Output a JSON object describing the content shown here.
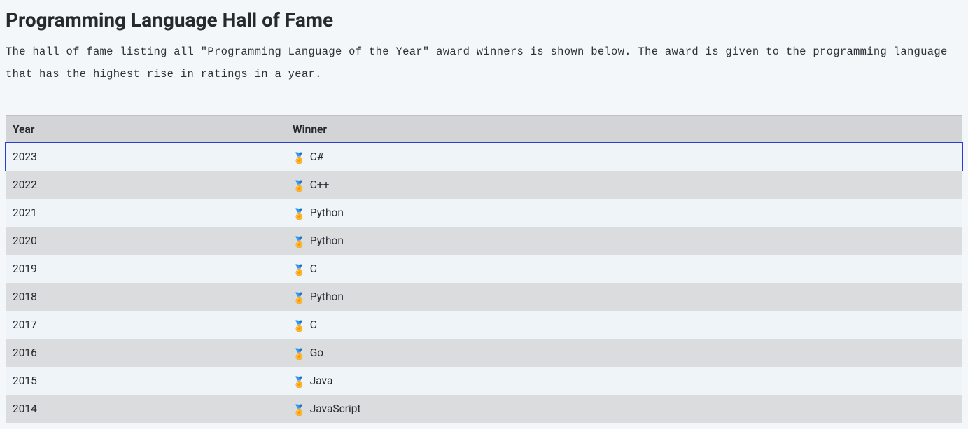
{
  "title": "Programming Language Hall of Fame",
  "intro": "The hall of fame listing all \"Programming Language of the Year\" award winners is shown below. The award is given to the programming language that has the highest rise in ratings in a year.",
  "table": {
    "headers": {
      "year": "Year",
      "winner": "Winner"
    },
    "rows": [
      {
        "year": "2023",
        "winner": "C#",
        "highlighted": true
      },
      {
        "year": "2022",
        "winner": "C++"
      },
      {
        "year": "2021",
        "winner": "Python"
      },
      {
        "year": "2020",
        "winner": "Python"
      },
      {
        "year": "2019",
        "winner": "C"
      },
      {
        "year": "2018",
        "winner": "Python"
      },
      {
        "year": "2017",
        "winner": "C"
      },
      {
        "year": "2016",
        "winner": "Go"
      },
      {
        "year": "2015",
        "winner": "Java"
      },
      {
        "year": "2014",
        "winner": "JavaScript"
      }
    ]
  },
  "icons": {
    "medal": "🏅"
  }
}
